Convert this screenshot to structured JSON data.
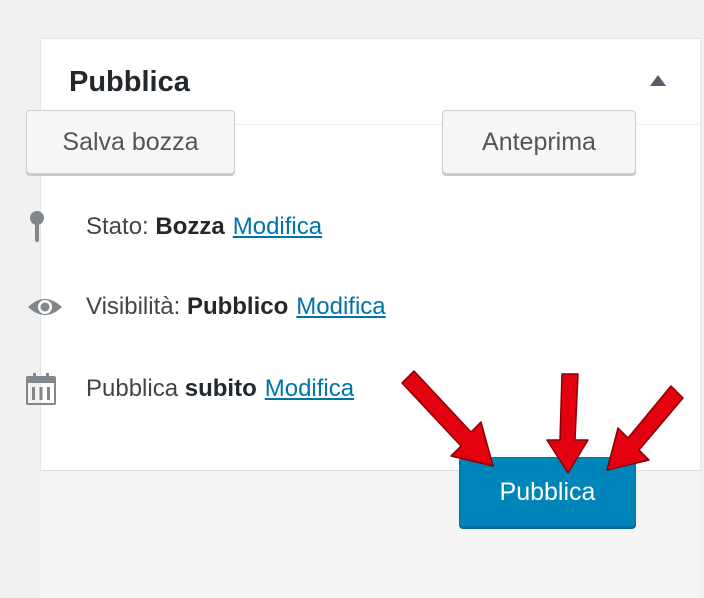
{
  "panel": {
    "title": "Pubblica",
    "toggle_icon": "triangle-up-icon"
  },
  "actions": {
    "save_draft_label": "Salva bozza",
    "preview_label": "Anteprima"
  },
  "status": {
    "icon": "pin-icon",
    "label": "Stato:",
    "value": "Bozza",
    "edit_link": "Modifica"
  },
  "visibility": {
    "icon": "eye-icon",
    "label": "Visibilità:",
    "value": "Pubblico",
    "edit_link": "Modifica"
  },
  "schedule": {
    "icon": "calendar-icon",
    "label": "Pubblica",
    "value": "subito",
    "edit_link": "Modifica"
  },
  "footer": {
    "publish_label": "Pubblica"
  },
  "annotations": {
    "arrow_color": "#e3000f",
    "arrow_count": 3
  },
  "colors": {
    "primary": "#0085ba",
    "link": "#0073aa"
  }
}
